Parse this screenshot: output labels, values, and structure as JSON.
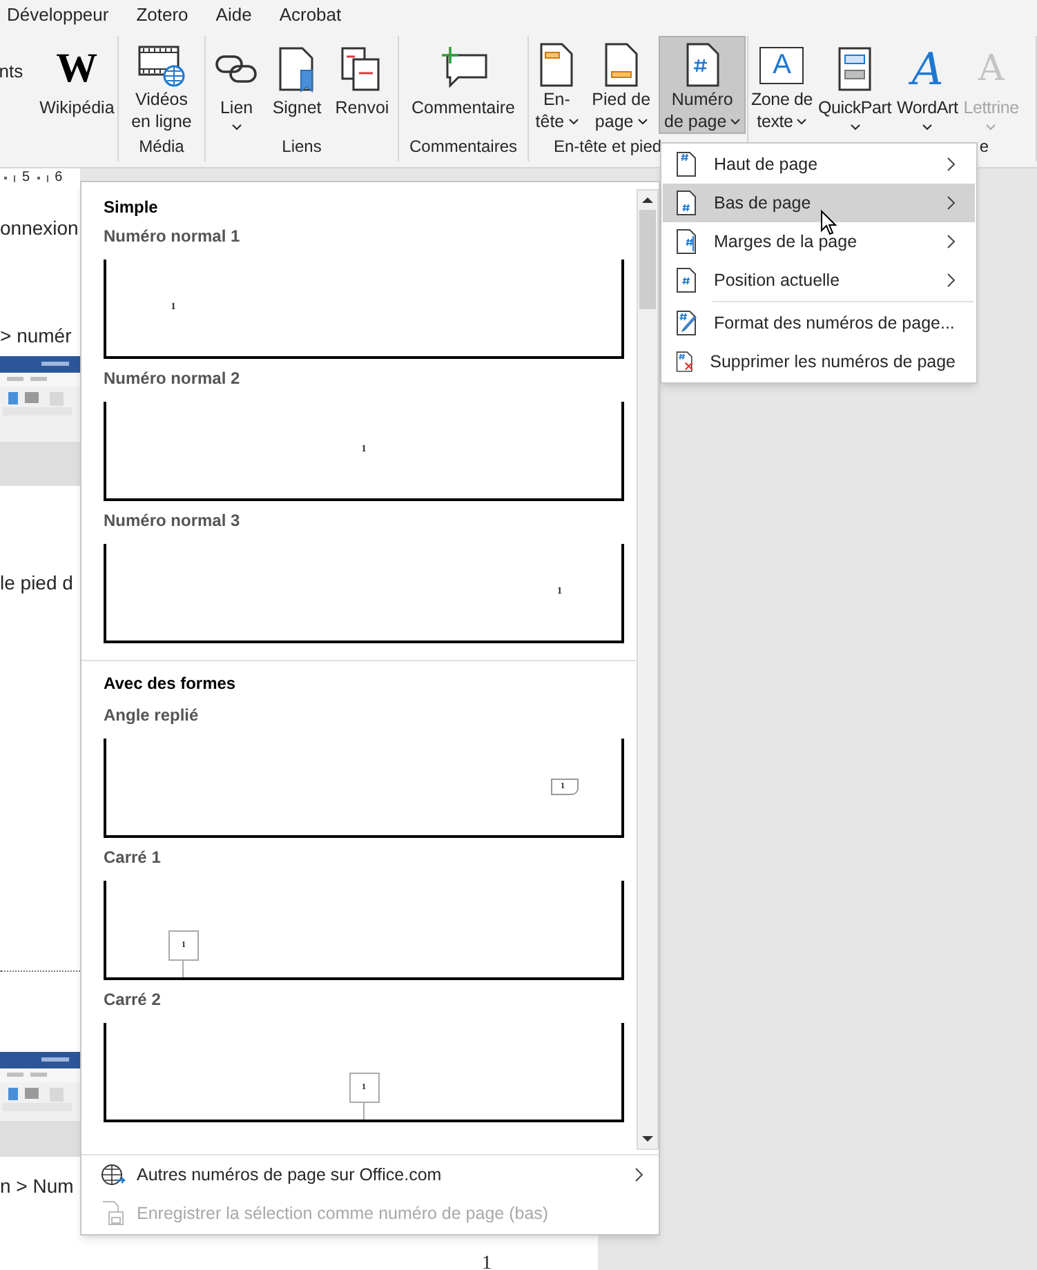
{
  "ribbon_tabs": [
    {
      "label": "Développeur"
    },
    {
      "label": "Zotero"
    },
    {
      "label": "Aide"
    },
    {
      "label": "Acrobat"
    }
  ],
  "ribbon_groups": [
    {
      "buttons": [
        {
          "kind": "cut",
          "lines": [
            "nts"
          ]
        },
        {
          "kind": "large",
          "icon_text": "W",
          "lines": [
            "Wikipédia"
          ],
          "dropdown": false,
          "selected": false,
          "disabled": false
        }
      ]
    },
    {
      "label": "Média",
      "buttons": [
        {
          "kind": "large",
          "lines": [
            "Vidéos",
            "en ligne"
          ],
          "dropdown": false,
          "selected": false,
          "disabled": false
        }
      ]
    },
    {
      "label": "Liens",
      "buttons": [
        {
          "kind": "large",
          "lines": [
            "Lien"
          ],
          "dropdown": true,
          "selected": false,
          "disabled": false
        },
        {
          "kind": "large",
          "lines": [
            "Signet"
          ],
          "dropdown": false,
          "selected": false,
          "disabled": false
        },
        {
          "kind": "large",
          "lines": [
            "Renvoi"
          ],
          "dropdown": false,
          "selected": false,
          "disabled": false
        }
      ]
    },
    {
      "label": "Commentaires",
      "buttons": [
        {
          "kind": "large",
          "lines": [
            "Commentaire"
          ],
          "dropdown": false,
          "selected": false,
          "disabled": false
        }
      ]
    },
    {
      "label": "En-tête et pied",
      "buttons": [
        {
          "kind": "large",
          "lines": [
            "En-",
            "tête"
          ],
          "dropdown": true,
          "selected": false,
          "disabled": false
        },
        {
          "kind": "large",
          "lines": [
            "Pied de",
            "page"
          ],
          "dropdown": true,
          "selected": false,
          "disabled": false
        },
        {
          "kind": "large",
          "lines": [
            "Numéro",
            "de page"
          ],
          "dropdown": true,
          "selected": true,
          "disabled": false
        }
      ]
    },
    {
      "label": "e",
      "buttons": [
        {
          "kind": "large",
          "icon_text": "A",
          "lines": [
            "Zone de",
            "texte"
          ],
          "dropdown": true,
          "selected": false,
          "disabled": false
        },
        {
          "kind": "large",
          "lines": [
            "QuickPart"
          ],
          "dropdown": true,
          "selected": false,
          "disabled": false
        },
        {
          "kind": "large",
          "icon_text": "A",
          "lines": [
            "WordArt"
          ],
          "dropdown": true,
          "selected": false,
          "disabled": false
        },
        {
          "kind": "large",
          "icon_text": "A",
          "lines": [
            "Lettrine"
          ],
          "dropdown": true,
          "selected": false,
          "disabled": true
        }
      ]
    }
  ],
  "ruler": {
    "marks": [
      "5",
      "6"
    ]
  },
  "document": {
    "blocks": [
      {
        "kind": "text",
        "text": "onnexion"
      },
      {
        "kind": "text",
        "text": "> numér"
      },
      {
        "kind": "picture"
      },
      {
        "kind": "text",
        "text": "le pied d"
      },
      {
        "kind": "rule"
      },
      {
        "kind": "picture"
      },
      {
        "kind": "text",
        "text": "n > Num"
      }
    ],
    "page_number": "1"
  },
  "page_number_menu": {
    "items": [
      {
        "label": "Haut de page",
        "kind": "top",
        "selected": false,
        "submenu": true
      },
      {
        "label": "Bas de page",
        "kind": "bottom",
        "selected": true,
        "submenu": true
      },
      {
        "label": "Marges de la page",
        "kind": "margin",
        "selected": false,
        "submenu": true
      },
      {
        "label": "Position actuelle",
        "kind": "current",
        "selected": false,
        "submenu": true
      }
    ],
    "actions": [
      {
        "label": "Format des numéros de page...",
        "kind": "format"
      },
      {
        "label": "Supprimer les numéros de page",
        "kind": "remove"
      }
    ]
  },
  "gallery": {
    "sections": [
      {
        "title": "Simple",
        "items": [
          {
            "label": "Numéro normal 1",
            "kind": "plain",
            "number": "1"
          },
          {
            "label": "Numéro normal 2",
            "kind": "plain",
            "number": "1"
          },
          {
            "label": "Numéro normal 3",
            "kind": "plain",
            "number": "1"
          }
        ]
      },
      {
        "title": "Avec des formes",
        "items": [
          {
            "label": "Angle replié",
            "kind": "folded",
            "number": "1"
          },
          {
            "label": "Carré 1",
            "kind": "square",
            "number": "1"
          },
          {
            "label": "Carré 2",
            "kind": "square",
            "number": "1"
          }
        ]
      }
    ],
    "footer": [
      {
        "label": "Autres numéros de page sur Office.com",
        "kind": "web",
        "disabled": false,
        "submenu": true
      },
      {
        "label": "Enregistrer la sélection comme numéro de page (bas)",
        "kind": "save",
        "disabled": true,
        "submenu": false
      }
    ]
  }
}
